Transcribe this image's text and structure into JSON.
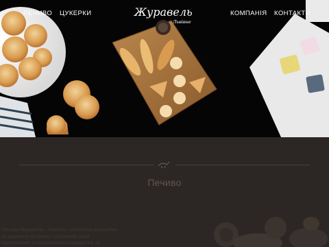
{
  "nav": {
    "cookies": "ПЕЧИВО",
    "candies": "ЦУКЕРКИ",
    "company": "КОМПАНІЯ",
    "contacts": "КОНТАКТИ"
  },
  "logo": {
    "main": "Журавель",
    "sub": "Львівне"
  },
  "section": {
    "title": "Печиво",
    "about_lines": [
      "Печиво Журавель - Львова – найменш калорійне",
      "та ароматні на смаку і вабливий смак",
      "приготоване з натуральних інгредієнтів за"
    ]
  }
}
